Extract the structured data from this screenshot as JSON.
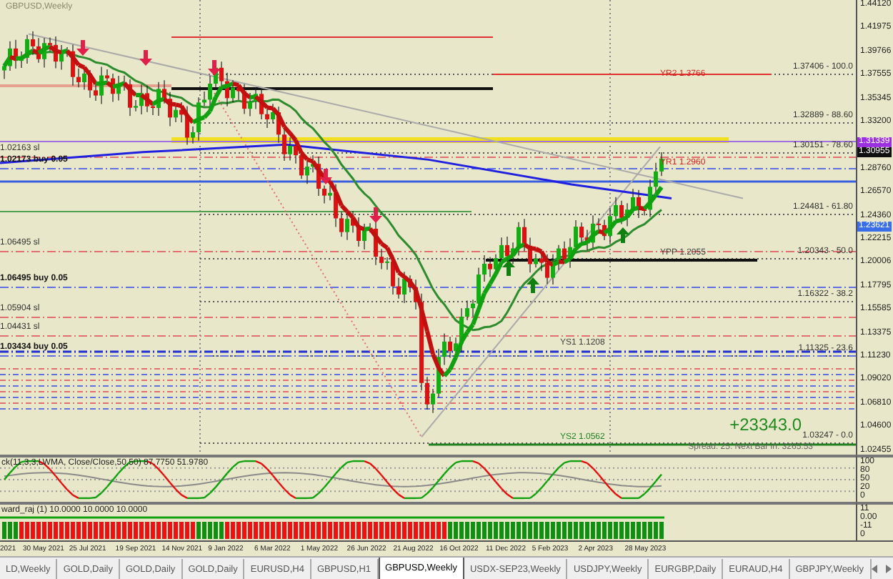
{
  "chart": {
    "title": "GBPUSD,Weekly",
    "profit": "+23343.0",
    "status": "Spread: 25. Next Bar in: 3265:53",
    "pivot_labels": [
      {
        "text": "YR2 1.3766",
        "color": "#d02020"
      },
      {
        "text": "YR1 1.2960",
        "color": "#d02020"
      },
      {
        "text": "YPP 1.2055",
        "color": "#404040"
      },
      {
        "text": "YS1 1.1208",
        "color": "#404040"
      },
      {
        "text": "YS2 1.0562",
        "color": "#208020"
      }
    ],
    "fib_labels": [
      "1.37406 - 100.0",
      "1.32889 - 88.60",
      "1.30151 - 78.60",
      "1.24481 - 61.80",
      "1.20343 - 50.0",
      "1.16322 - 38.2",
      "1.11325 - 23.6",
      "1.03247 - 0.0"
    ],
    "order_labels": [
      {
        "text": "1.02163 sl",
        "kind": "stop"
      },
      {
        "text": "1.02173 buy 0.05",
        "kind": "order"
      },
      {
        "text": "1.06495 sl",
        "kind": "stop"
      },
      {
        "text": "1.06495 buy 0.05",
        "kind": "order"
      },
      {
        "text": "1.05904 sl",
        "kind": "stop"
      },
      {
        "text": "1.04431 sl",
        "kind": "stop"
      },
      {
        "text": "1.03434 buy 0.05",
        "kind": "order"
      }
    ]
  },
  "price_axis": [
    {
      "text": "1.44120",
      "kind": "tick"
    },
    {
      "text": "1.41975",
      "kind": "tick"
    },
    {
      "text": "1.39766",
      "kind": "tick"
    },
    {
      "text": "1.37555",
      "kind": "tick"
    },
    {
      "text": "1.35345",
      "kind": "tick"
    },
    {
      "text": "1.33200",
      "kind": "tick"
    },
    {
      "text": "1.31339",
      "kind": "badge",
      "color": "#9b30e0"
    },
    {
      "text": "1.30955",
      "kind": "badge",
      "color": "#101010"
    },
    {
      "text": "1.28760",
      "kind": "tick"
    },
    {
      "text": "1.26570",
      "kind": "tick"
    },
    {
      "text": "1.24360",
      "kind": "tick"
    },
    {
      "text": "1.23621",
      "kind": "badge",
      "color": "#3a6ee8"
    },
    {
      "text": "1.22215",
      "kind": "tick"
    },
    {
      "text": "1.20006",
      "kind": "tick"
    },
    {
      "text": "1.17795",
      "kind": "tick"
    },
    {
      "text": "1.15585",
      "kind": "tick"
    },
    {
      "text": "1.13375",
      "kind": "tick"
    },
    {
      "text": "1.11230",
      "kind": "tick"
    },
    {
      "text": "1.09020",
      "kind": "tick"
    },
    {
      "text": "1.06810",
      "kind": "tick"
    },
    {
      "text": "1.04600",
      "kind": "tick"
    },
    {
      "text": "1.02455",
      "kind": "tick"
    }
  ],
  "oscillator": {
    "label": "ck(11,3,3,LWMA, Close/Close,50,50) 87.7750 51.9780",
    "axis": [
      "100",
      "80",
      "50",
      "20",
      "0"
    ]
  },
  "histogram": {
    "label": "ward_raj (1) 10.0000 10.0000 10.0000",
    "axis": [
      "11",
      "0.00",
      "-11",
      "0"
    ]
  },
  "dates": [
    "2021",
    "30 May 2021",
    "25 Jul 2021",
    "19 Sep 2021",
    "14 Nov 2021",
    "9 Jan 2022",
    "6 Mar 2022",
    "1 May 2022",
    "26 Jun 2022",
    "21 Aug 2022",
    "16 Oct 2022",
    "11 Dec 2022",
    "5 Feb 2023",
    "2 Apr 2023",
    "28 May 2023"
  ],
  "tabs": [
    {
      "label": "LD,Weekly",
      "selected": false
    },
    {
      "label": "GOLD,Daily",
      "selected": false
    },
    {
      "label": "GOLD,Daily",
      "selected": false
    },
    {
      "label": "GOLD,Daily",
      "selected": false
    },
    {
      "label": "EURUSD,H4",
      "selected": false
    },
    {
      "label": "GBPUSD,H1",
      "selected": false
    },
    {
      "label": "GBPUSD,Weekly",
      "selected": true
    },
    {
      "label": "USDX-SEP23,Weekly",
      "selected": false
    },
    {
      "label": "USDJPY,Weekly",
      "selected": false
    },
    {
      "label": "EURGBP,Daily",
      "selected": false
    },
    {
      "label": "EURAUD,H4",
      "selected": false
    },
    {
      "label": "GBPJPY,Weekly",
      "selected": false
    }
  ]
}
